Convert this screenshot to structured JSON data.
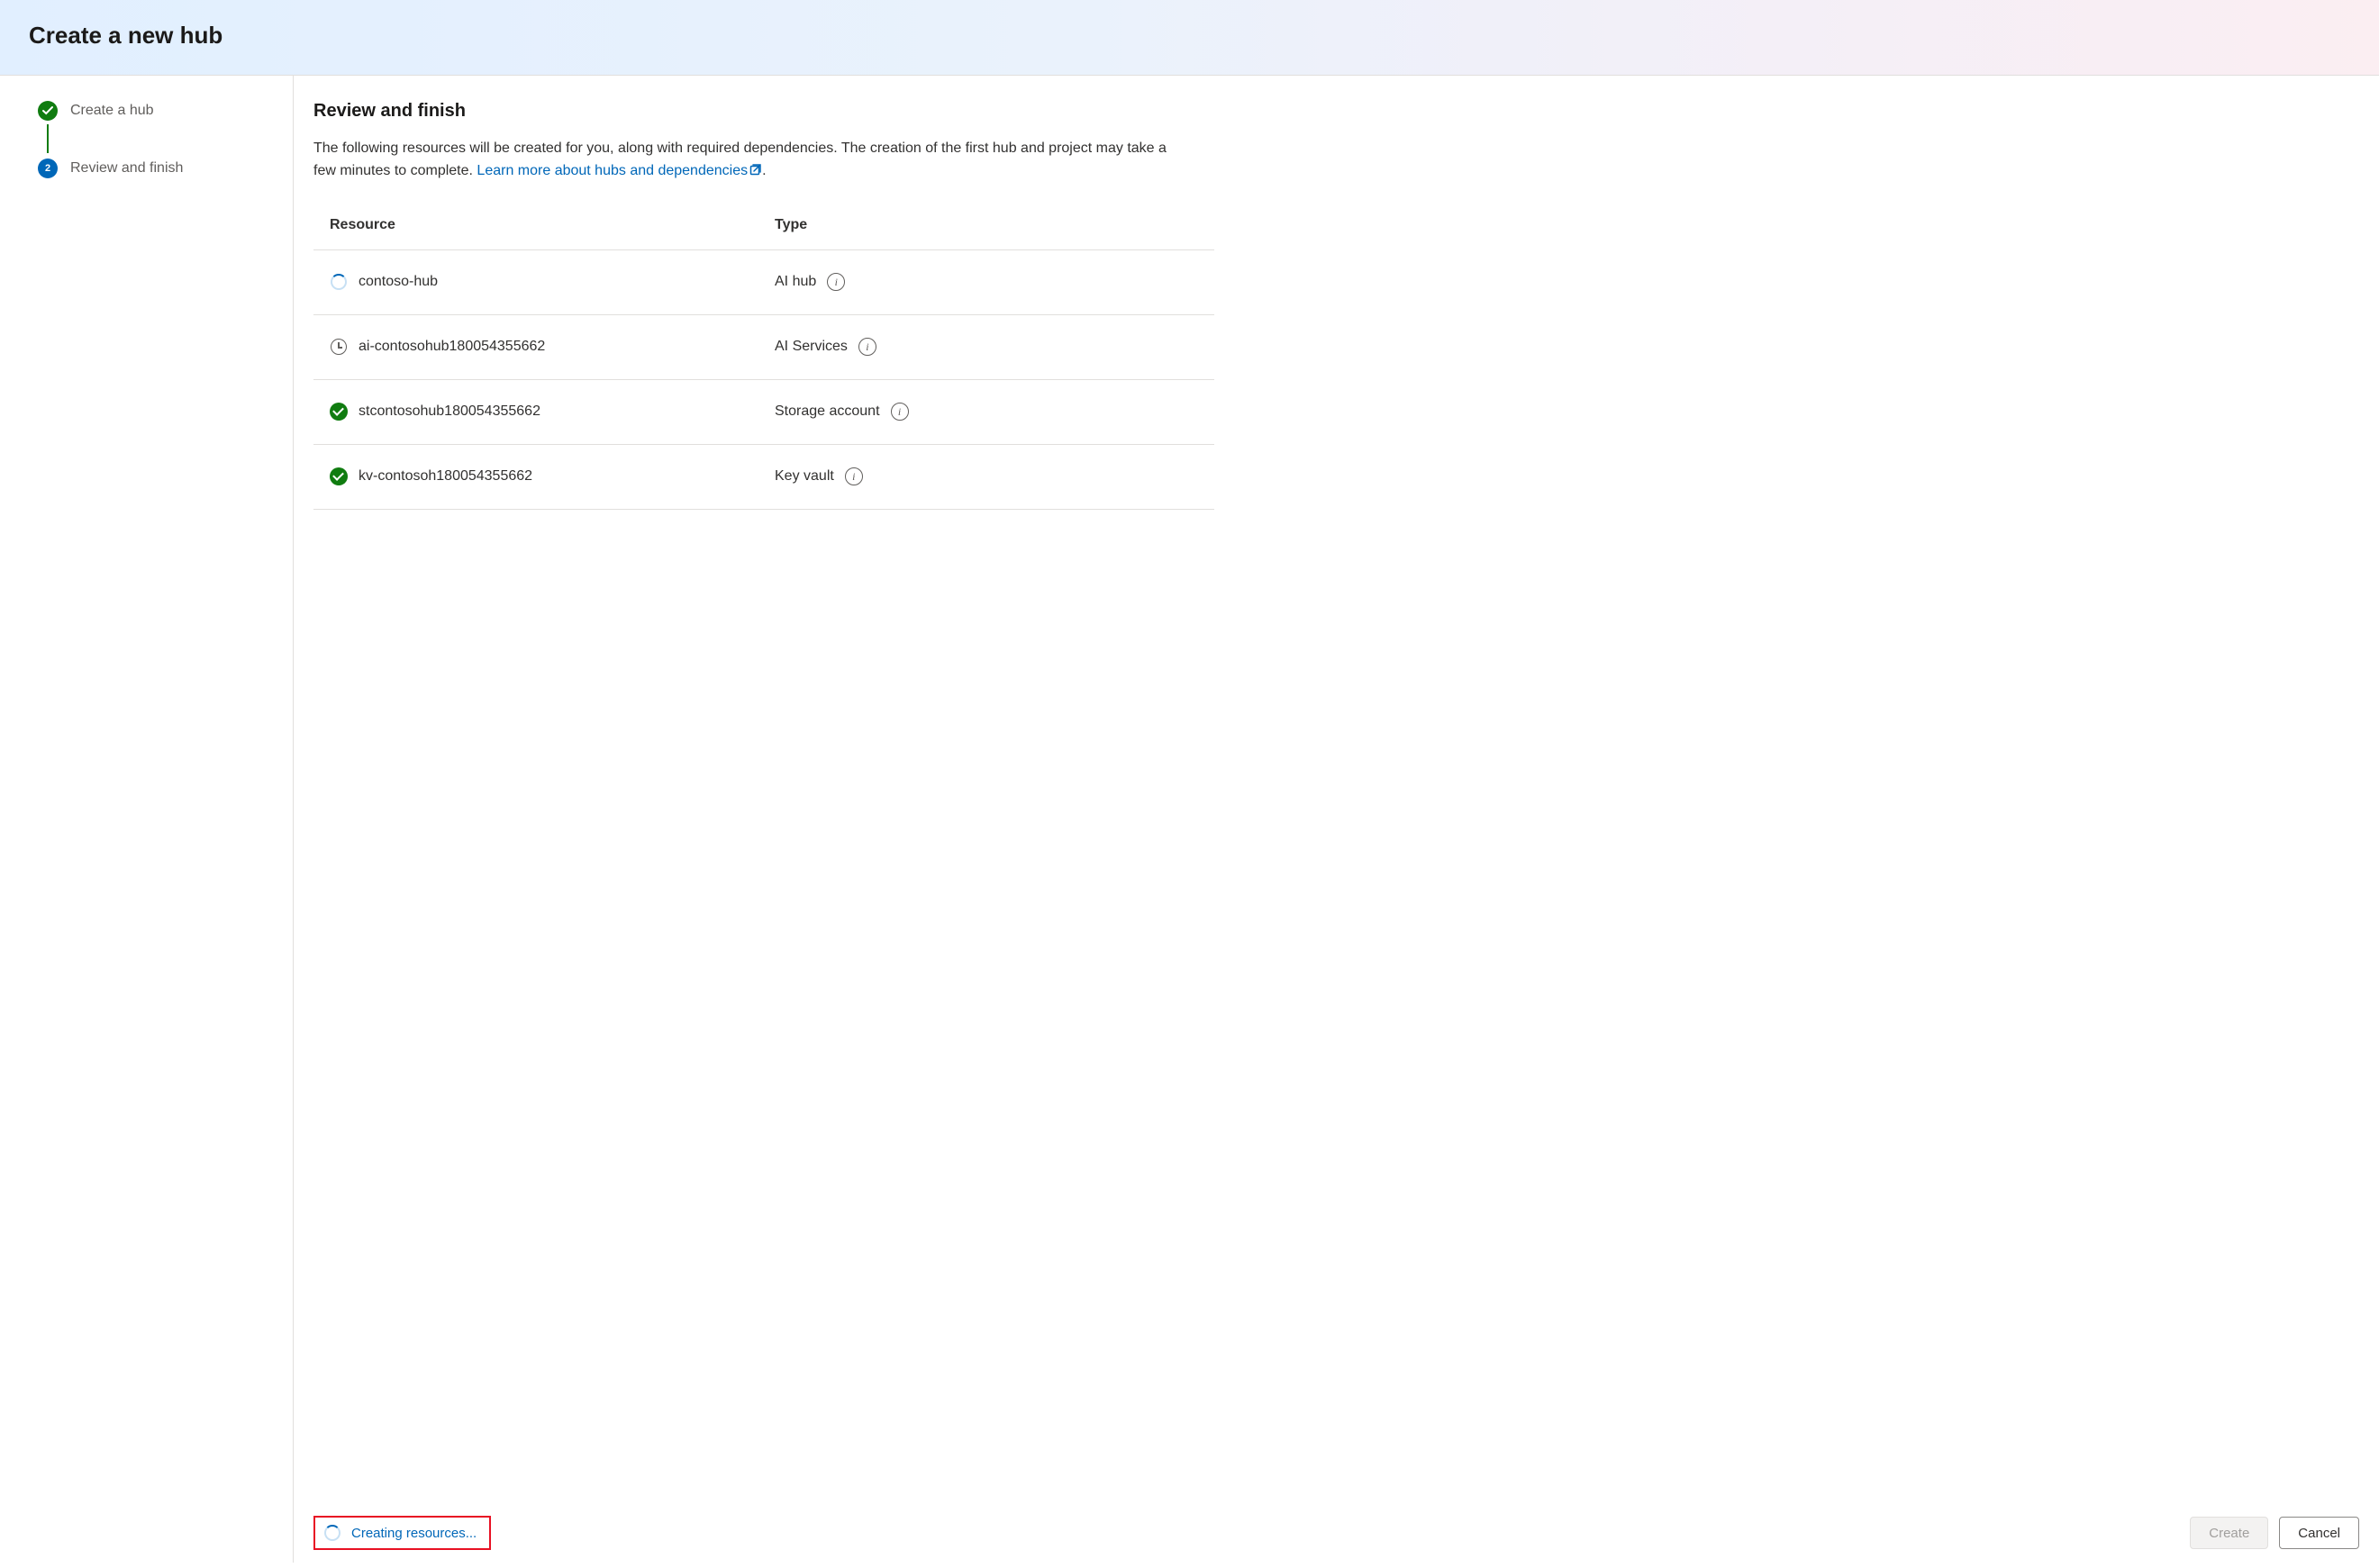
{
  "header": {
    "title": "Create a new hub"
  },
  "steps": [
    {
      "label": "Create a hub",
      "state": "done"
    },
    {
      "label": "Review and finish",
      "state": "current",
      "number": "2"
    }
  ],
  "main": {
    "title": "Review and finish",
    "description_pre": "The following resources will be created for you, along with required dependencies. The creation of the first hub and project may take a few minutes to complete. ",
    "learn_link": "Learn more about hubs and dependencies",
    "description_post": "."
  },
  "table": {
    "headers": {
      "resource": "Resource",
      "type": "Type"
    },
    "rows": [
      {
        "status": "spinner",
        "name": "contoso-hub",
        "type": "AI hub"
      },
      {
        "status": "clock",
        "name": "ai-contosohub180054355662",
        "type": "AI Services"
      },
      {
        "status": "check",
        "name": "stcontosohub180054355662",
        "type": "Storage account"
      },
      {
        "status": "check",
        "name": "kv-contosoh180054355662",
        "type": "Key vault"
      }
    ]
  },
  "footer": {
    "status_text": "Creating resources...",
    "create_label": "Create",
    "cancel_label": "Cancel"
  }
}
